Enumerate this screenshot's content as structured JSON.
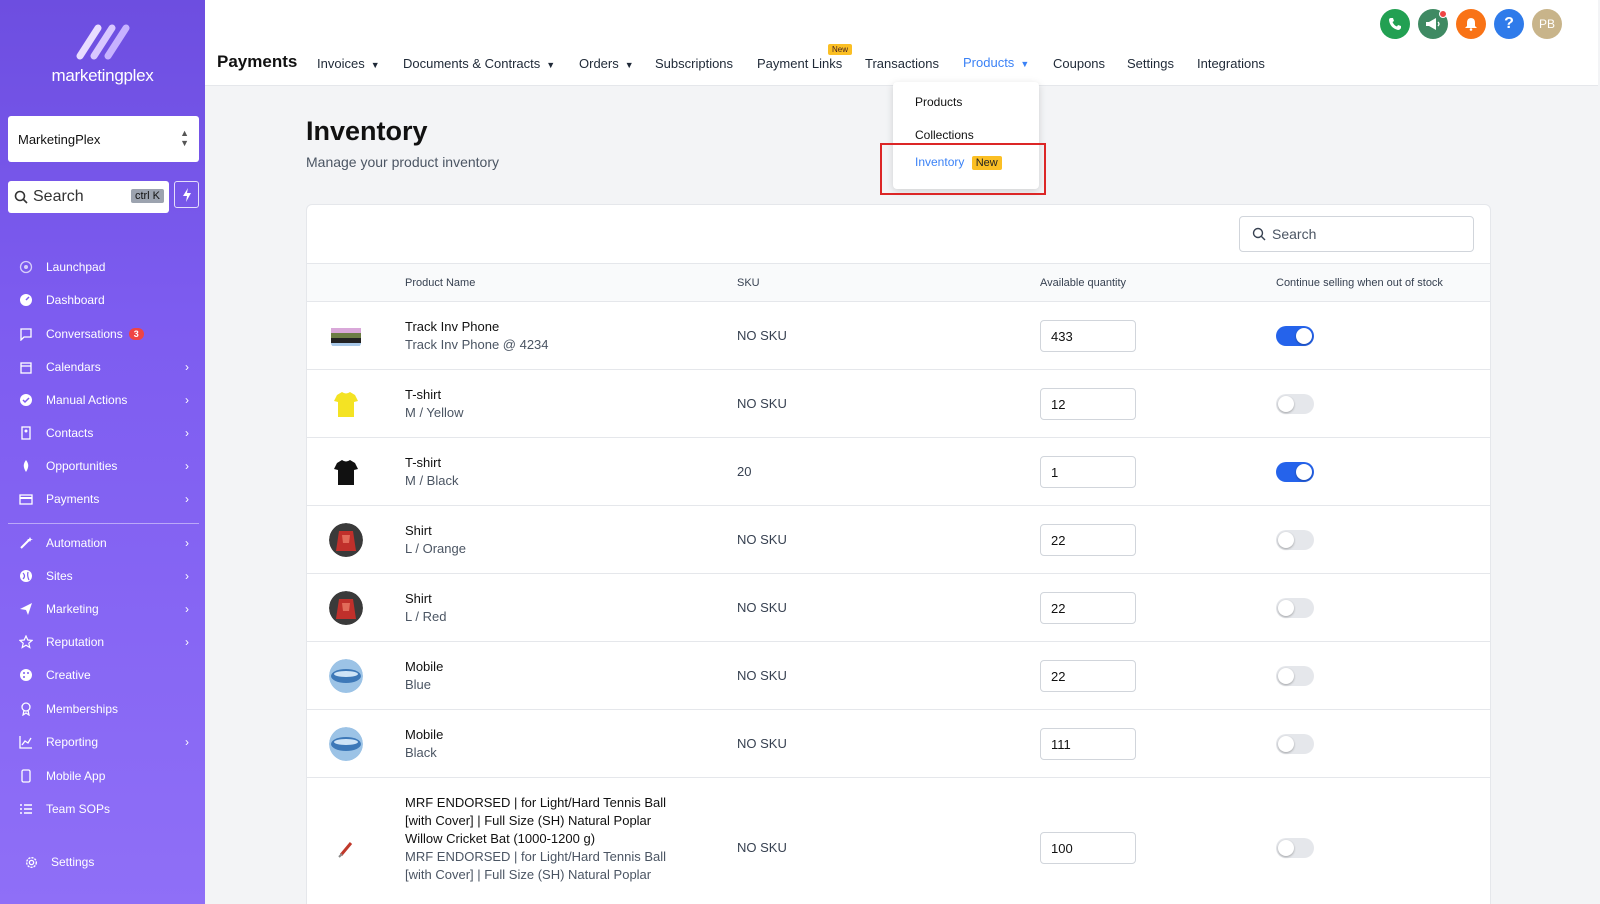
{
  "sidebar": {
    "logo_text": "marketingplex",
    "account": "MarketingPlex",
    "search_placeholder": "Search",
    "search_shortcut": "ctrl K",
    "items": [
      {
        "label": "Launchpad"
      },
      {
        "label": "Dashboard"
      },
      {
        "label": "Conversations",
        "badge": "3"
      },
      {
        "label": "Calendars"
      },
      {
        "label": "Manual Actions"
      },
      {
        "label": "Contacts"
      },
      {
        "label": "Opportunities"
      },
      {
        "label": "Payments"
      },
      {
        "label": "Automation"
      },
      {
        "label": "Sites"
      },
      {
        "label": "Marketing"
      },
      {
        "label": "Reputation"
      },
      {
        "label": "Creative"
      },
      {
        "label": "Memberships"
      },
      {
        "label": "Reporting"
      },
      {
        "label": "Mobile App"
      },
      {
        "label": "Team SOPs"
      },
      {
        "label": "Settings"
      }
    ]
  },
  "header": {
    "title": "Payments",
    "tabs": [
      {
        "label": "Invoices"
      },
      {
        "label": "Documents & Contracts"
      },
      {
        "label": "Orders"
      },
      {
        "label": "Subscriptions"
      },
      {
        "label": "Payment Links",
        "badge": "New"
      },
      {
        "label": "Transactions"
      },
      {
        "label": "Products"
      },
      {
        "label": "Coupons"
      },
      {
        "label": "Settings"
      },
      {
        "label": "Integrations"
      }
    ],
    "avatar_initials": "PB",
    "help_glyph": "?"
  },
  "dropdown": {
    "items": [
      {
        "label": "Products"
      },
      {
        "label": "Collections"
      },
      {
        "label": "Inventory",
        "badge": "New"
      }
    ]
  },
  "page": {
    "title": "Inventory",
    "subtitle": "Manage your product inventory",
    "search_placeholder": "Search"
  },
  "table": {
    "columns": [
      "Product Name",
      "SKU",
      "Available quantity",
      "Continue selling when out of stock"
    ],
    "rows": [
      {
        "name": "Track Inv Phone",
        "variant": "Track Inv Phone @ 4234",
        "sku": "NO SKU",
        "qty": "433",
        "continue_selling": true
      },
      {
        "name": "T-shirt",
        "variant": "M / Yellow",
        "sku": "NO SKU",
        "qty": "12",
        "continue_selling": false
      },
      {
        "name": "T-shirt",
        "variant": "M / Black",
        "sku": "20",
        "qty": "1",
        "continue_selling": true
      },
      {
        "name": "Shirt",
        "variant": "L / Orange",
        "sku": "NO SKU",
        "qty": "22",
        "continue_selling": false
      },
      {
        "name": "Shirt",
        "variant": "L / Red",
        "sku": "NO SKU",
        "qty": "22",
        "continue_selling": false
      },
      {
        "name": "Mobile",
        "variant": "Blue",
        "sku": "NO SKU",
        "qty": "22",
        "continue_selling": false
      },
      {
        "name": "Mobile",
        "variant": "Black",
        "sku": "NO SKU",
        "qty": "111",
        "continue_selling": false
      },
      {
        "name": "MRF ENDORSED | for Light/Hard Tennis Ball [with Cover] | Full Size (SH) Natural Poplar Willow Cricket Bat (1000-1200 g)",
        "variant": "MRF ENDORSED | for Light/Hard Tennis Ball [with Cover] | Full Size (SH) Natural Poplar",
        "sku": "NO SKU",
        "qty": "100",
        "continue_selling": false
      }
    ]
  },
  "colors": {
    "accent": "#3b82f6",
    "toggle_on": "#2563eb",
    "sidebar": "#7d5cf0",
    "new_badge": "#fbbf24",
    "highlight": "#dc2626"
  }
}
